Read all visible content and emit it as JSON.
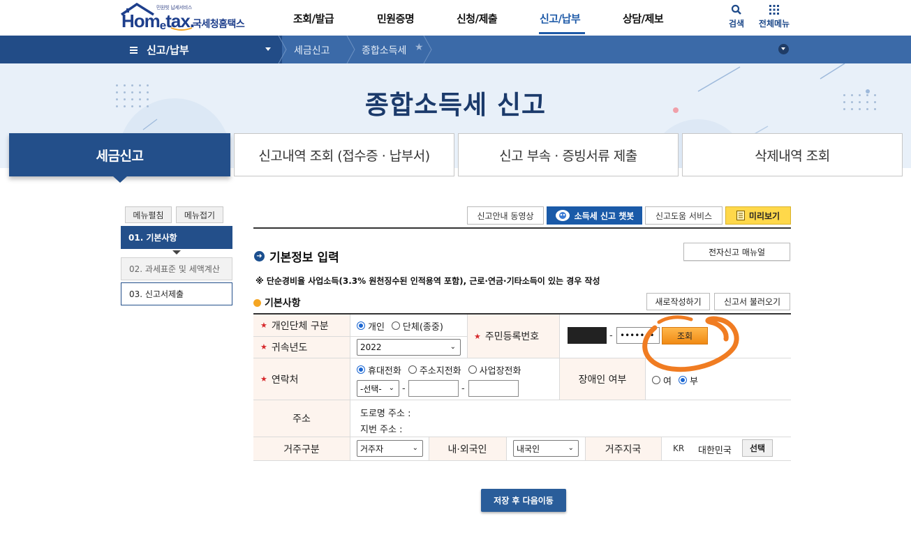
{
  "header": {
    "logo_small": "민원빗 납세서비스",
    "logo_main": "Hom",
    "logo_e": "e",
    "logo_tax": "tax.",
    "logo_sub": "국세청홈택스",
    "nav": [
      "조회/발급",
      "민원증명",
      "신청/제출",
      "신고/납부",
      "상담/제보"
    ],
    "active_nav": "신고/납부",
    "search_label": "검색",
    "allmenu_label": "전체메뉴",
    "search_icon": "magnifier",
    "allmenu_icon": "grid-9-dots"
  },
  "location": {
    "menu_label": "신고/납부",
    "crumbs": [
      "세금신고",
      "종합소득세"
    ]
  },
  "hero": {
    "title": "종합소득세 신고"
  },
  "tabs": [
    "세금신고",
    "신고내역 조회 (접수증 · 납부서)",
    "신고 부속 · 증빙서류 제출",
    "삭제내역 조회"
  ],
  "side": {
    "expand": "메뉴펼침",
    "collapse": "메뉴접기",
    "steps": [
      "01. 기본사항",
      "02. 과세표준 및 세액계산",
      "03. 신고서제출"
    ]
  },
  "toolbar": {
    "video": "신고안내 동영상",
    "chatbot": "소득세 신고 챗봇",
    "help": "신고도움 서비스",
    "preview": "미리보기"
  },
  "section": {
    "title": "기본정보 입력",
    "manual": "전자신고 매뉴얼",
    "notice": "※ 단순경비율 사업소득(3.3% 원천징수된 인적용역 포함), 근로·연금·기타소득이 있는 경우 작성",
    "subtitle": "기본사항",
    "new_btn": "새로작성하기",
    "load_btn": "신고서 불러오기"
  },
  "form": {
    "entity_label": "개인단체 구분",
    "entity_opts": [
      "개인",
      "단체(종중)"
    ],
    "entity_selected": "개인",
    "year_label": "귀속년도",
    "year_value": "2022",
    "rrn_label": "주민등록번호",
    "rrn_masked": "•••••••",
    "lookup_btn": "조회",
    "contact_label": "연락처",
    "contact_opts": [
      "휴대전화",
      "주소지전화",
      "사업장전화"
    ],
    "contact_selected": "휴대전화",
    "phone_prefix": "-선택-",
    "disabled_label": "장애인 여부",
    "disabled_opts": [
      "여",
      "부"
    ],
    "disabled_selected": "부",
    "address_label": "주소",
    "road_addr": "도로명 주소 :",
    "lot_addr": "지번 주소 :",
    "residence_label": "거주구분",
    "residence_value": "거주자",
    "national_label": "내·외국인",
    "national_value": "내국인",
    "country_label": "거주지국",
    "country_code": "KR",
    "country_name": "대한민국",
    "select_btn": "선택"
  },
  "save_btn": "저장 후 다음이동",
  "colors": {
    "brand": "#234f8a",
    "accent_orange": "#f08a14",
    "annotation": "#f07c22"
  }
}
